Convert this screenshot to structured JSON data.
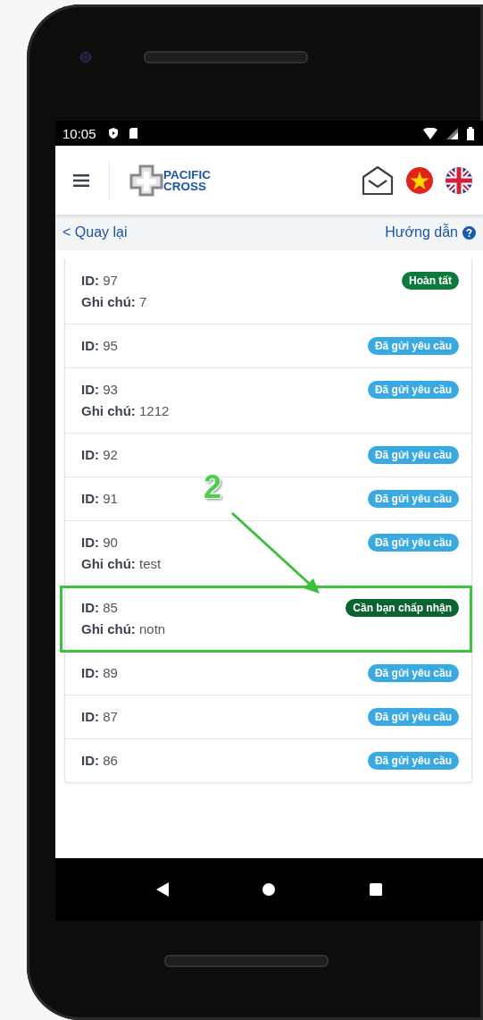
{
  "status_bar": {
    "time": "10:05"
  },
  "header": {
    "logo_line1": "PACIFIC",
    "logo_line2": "CROSS"
  },
  "nav": {
    "back": "< Quay lại",
    "help": "Hướng dẫn"
  },
  "rows": [
    {
      "id": "**ID:** 97",
      "note": "**Ghi chú:** 7",
      "status": "Hoàn tất",
      "kind": "done",
      "highlighted": false
    },
    {
      "id": "**ID:** 95",
      "status": "Đã gửi yêu cầu",
      "kind": "sent",
      "highlighted": false
    },
    {
      "id": "**ID:** 93",
      "note": "**Ghi chú:** 1212",
      "status": "Đã gửi yêu cầu",
      "kind": "sent",
      "highlighted": false
    },
    {
      "id": "**ID:** 92",
      "status": "Đã gửi yêu cầu",
      "kind": "sent",
      "highlighted": false
    },
    {
      "id": "**ID:** 91",
      "status": "Đã gửi yêu cầu",
      "kind": "sent",
      "highlighted": false
    },
    {
      "id": "**ID:** 90",
      "note": "**Ghi chú:** test",
      "status": "Đã gửi yêu cầu",
      "kind": "sent",
      "highlighted": false
    },
    {
      "id": "**ID:** 85",
      "note": "**Ghi chú:** notn",
      "status": "Cần bạn chấp nhận",
      "kind": "accept",
      "highlighted": true
    },
    {
      "id": "**ID:** 89",
      "status": "Đã gửi yêu cầu",
      "kind": "sent",
      "highlighted": false
    },
    {
      "id": "**ID:** 87",
      "status": "Đã gửi yêu cầu",
      "kind": "sent",
      "highlighted": false
    },
    {
      "id": "**ID:** 86",
      "status": "Đã gửi yêu cầu",
      "kind": "sent",
      "highlighted": false
    }
  ],
  "annotation": {
    "label": "2"
  }
}
